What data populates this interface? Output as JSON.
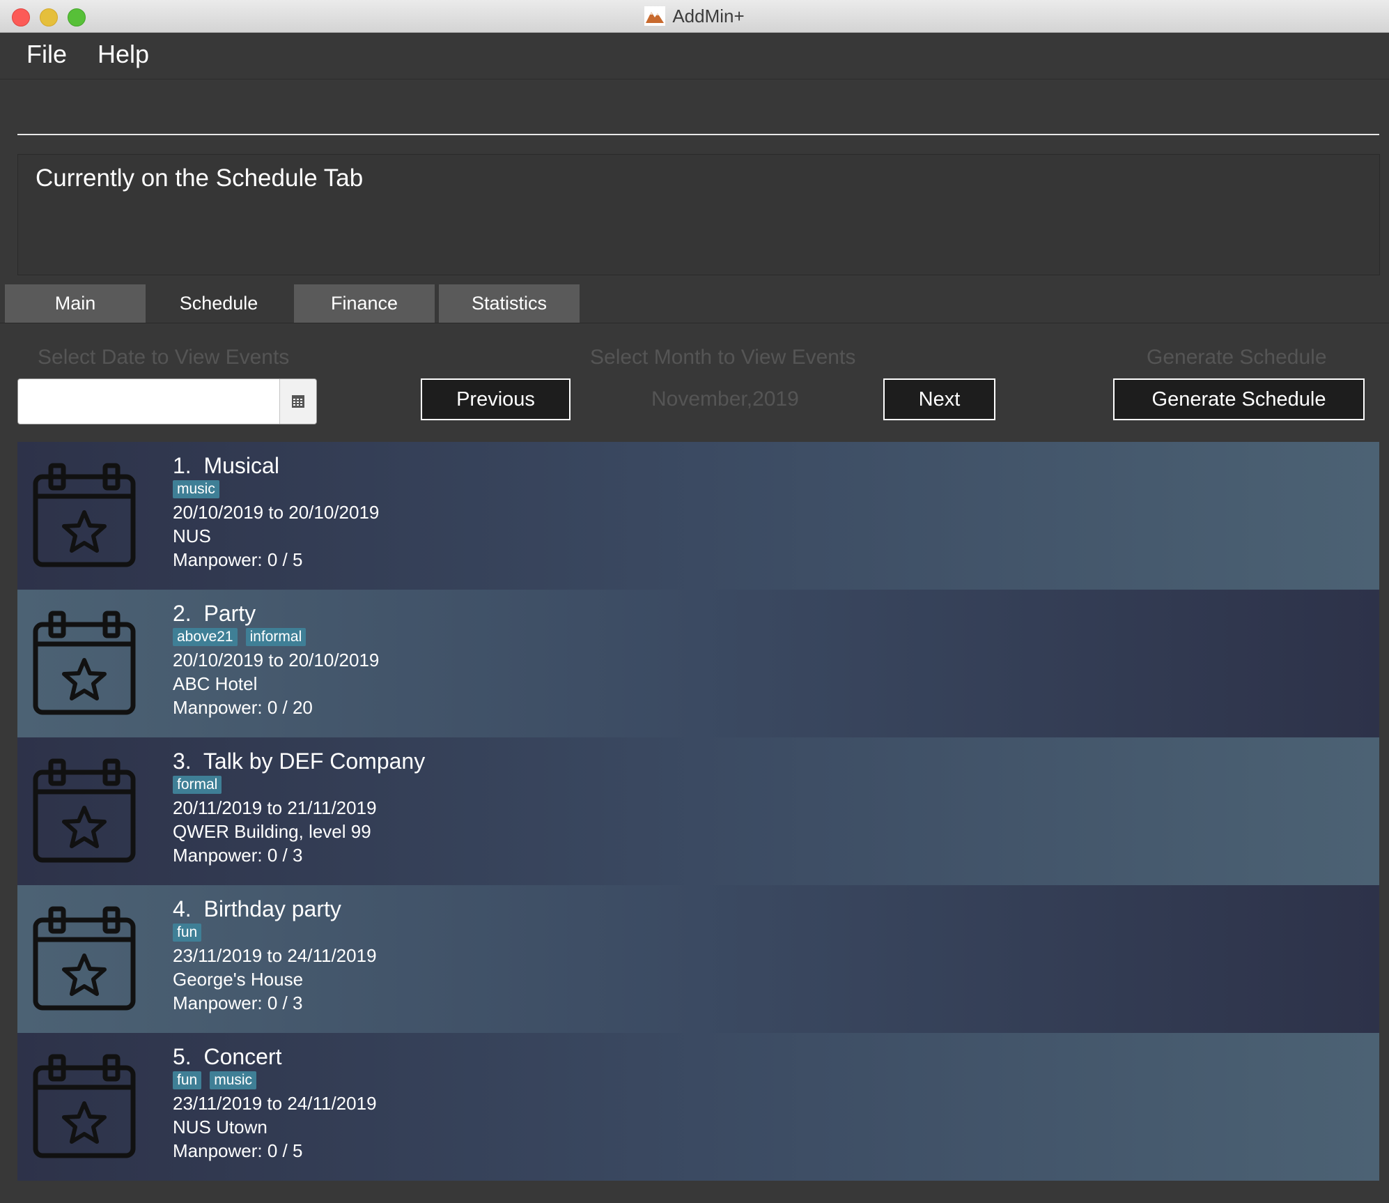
{
  "window": {
    "title": "AddMin+"
  },
  "menu": {
    "file": "File",
    "help": "Help"
  },
  "command": {
    "value": ""
  },
  "result": {
    "text": "Currently on the Schedule Tab"
  },
  "tabs": [
    {
      "label": "Main",
      "active": false
    },
    {
      "label": "Schedule",
      "active": true
    },
    {
      "label": "Finance",
      "active": false
    },
    {
      "label": "Statistics",
      "active": false
    }
  ],
  "schedule": {
    "date_label": "Select Date to View Events",
    "date_value": "",
    "month_label": "Select Month to View Events",
    "previous": "Previous",
    "current_month": "November,2019",
    "next": "Next",
    "generate_label": "Generate Schedule",
    "generate_button": "Generate Schedule"
  },
  "events": [
    {
      "index": "1.",
      "name": "Musical",
      "tags": [
        "music"
      ],
      "dates": "20/10/2019 to 20/10/2019",
      "venue": "NUS",
      "manpower": "Manpower: 0 / 5"
    },
    {
      "index": "2.",
      "name": "Party",
      "tags": [
        "above21",
        "informal"
      ],
      "dates": "20/10/2019 to 20/10/2019",
      "venue": "ABC Hotel",
      "manpower": "Manpower: 0 / 20"
    },
    {
      "index": "3.",
      "name": "Talk by DEF Company",
      "tags": [
        "formal"
      ],
      "dates": "20/11/2019 to 21/11/2019",
      "venue": "QWER Building, level 99",
      "manpower": "Manpower: 0 / 3"
    },
    {
      "index": "4.",
      "name": "Birthday party",
      "tags": [
        "fun"
      ],
      "dates": "23/11/2019 to 24/11/2019",
      "venue": "George's House",
      "manpower": "Manpower: 0 / 3"
    },
    {
      "index": "5.",
      "name": "Concert",
      "tags": [
        "fun",
        "music"
      ],
      "dates": "23/11/2019 to 24/11/2019",
      "venue": "NUS Utown",
      "manpower": "Manpower: 0 / 5"
    }
  ],
  "icons": {
    "event_icon": "calendar-star-icon",
    "date_picker_icon": "calendar-icon",
    "app_icon": "mountain-logo-icon"
  },
  "colors": {
    "background": "#383838",
    "tag": "#3f7f96",
    "card_dark": "#2d3249",
    "card_light": "#4c6274",
    "button": "#1d1d1d"
  }
}
